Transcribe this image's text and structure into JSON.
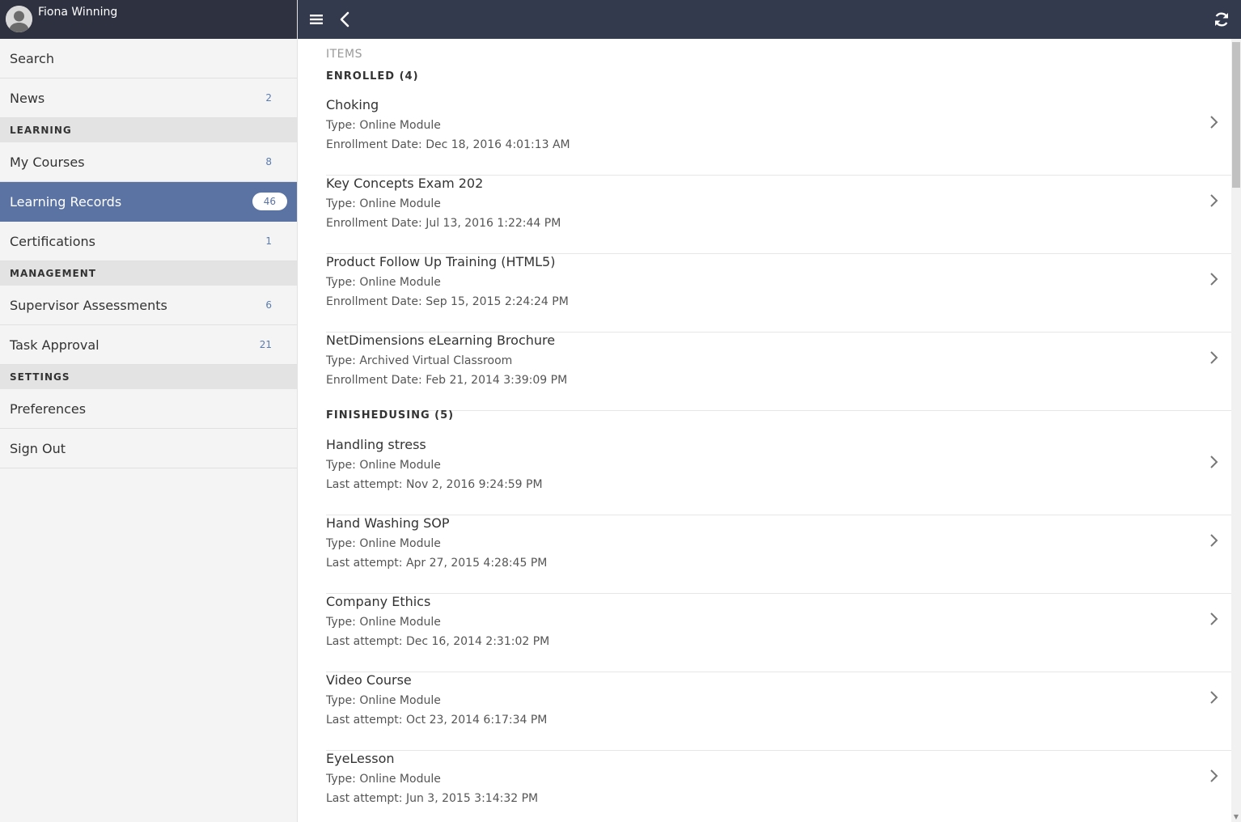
{
  "user": {
    "name": "Fiona Winning"
  },
  "sidebar": {
    "top_items": [
      {
        "label": "Search",
        "count": ""
      },
      {
        "label": "News",
        "count": "2"
      }
    ],
    "sections": [
      {
        "title": "LEARNING",
        "items": [
          {
            "label": "My Courses",
            "count": "8"
          },
          {
            "label": "Learning Records",
            "count": "46",
            "active": true
          },
          {
            "label": "Certifications",
            "count": "1"
          }
        ]
      },
      {
        "title": "MANAGEMENT",
        "items": [
          {
            "label": "Supervisor Assessments",
            "count": "6"
          },
          {
            "label": "Task Approval",
            "count": "21"
          }
        ]
      },
      {
        "title": "SETTINGS",
        "items": [
          {
            "label": "Preferences",
            "count": ""
          },
          {
            "label": "Sign Out",
            "count": ""
          }
        ]
      }
    ]
  },
  "topbar": {
    "icons": {
      "menu": "hamburger-menu-icon",
      "back": "chevron-left-icon",
      "refresh": "refresh-icon"
    }
  },
  "content": {
    "items_label": "ITEMS",
    "groups": [
      {
        "title": "ENROLLED (4)",
        "items": [
          {
            "title": "Choking",
            "type": "Type: Online Module",
            "date": "Enrollment Date: Dec 18, 2016 4:01:13 AM"
          },
          {
            "title": "Key Concepts Exam 202",
            "type": "Type: Online Module",
            "date": "Enrollment Date: Jul 13, 2016 1:22:44 PM"
          },
          {
            "title": "Product Follow Up Training (HTML5)",
            "type": "Type: Online Module",
            "date": "Enrollment Date: Sep 15, 2015 2:24:24 PM"
          },
          {
            "title": "NetDimensions eLearning Brochure",
            "type": "Type: Archived Virtual Classroom",
            "date": "Enrollment Date: Feb 21, 2014 3:39:09 PM"
          }
        ]
      },
      {
        "title": "FINISHEDUSING (5)",
        "items": [
          {
            "title": "Handling stress",
            "type": "Type: Online Module",
            "date": "Last attempt: Nov 2, 2016 9:24:59 PM"
          },
          {
            "title": "Hand Washing SOP",
            "type": "Type: Online Module",
            "date": "Last attempt: Apr 27, 2015 4:28:45 PM"
          },
          {
            "title": "Company Ethics",
            "type": "Type: Online Module",
            "date": "Last attempt: Dec 16, 2014 2:31:02 PM"
          },
          {
            "title": "Video Course",
            "type": "Type: Online Module",
            "date": "Last attempt: Oct 23, 2014 6:17:34 PM"
          },
          {
            "title": "EyeLesson",
            "type": "Type: Online Module",
            "date": "Last attempt: Jun 3, 2015 3:14:32 PM"
          }
        ]
      }
    ]
  },
  "colors": {
    "topbar": "#343a4d",
    "profile_bar": "#2d3140",
    "active_item": "#5b73a3",
    "count_text": "#5b7cb0"
  }
}
